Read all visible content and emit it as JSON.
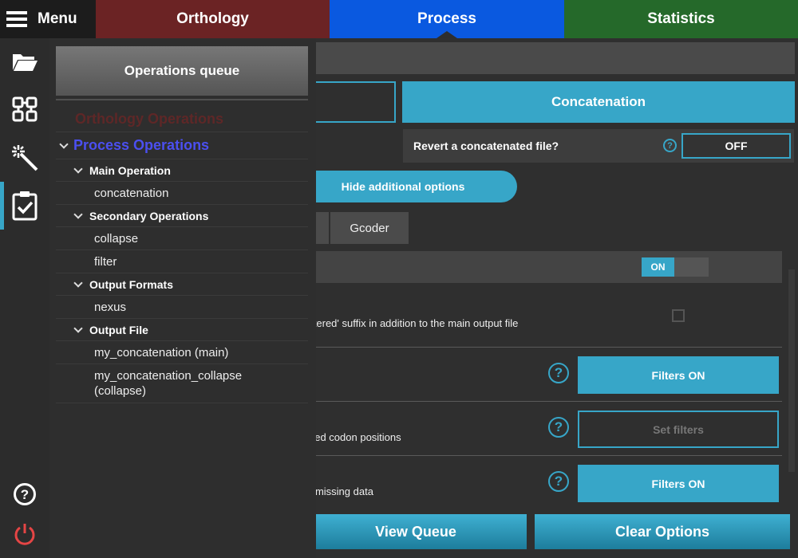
{
  "menu": {
    "label": "Menu"
  },
  "tabs": [
    {
      "label": "Orthology",
      "color": "#6b2324"
    },
    {
      "label": "Process",
      "color": "#0a59e0",
      "active": true
    },
    {
      "label": "Statistics",
      "color": "#25692a"
    }
  ],
  "rail": {
    "icons": [
      "folder-open-icon",
      "modules-icon",
      "magic-wand-icon",
      "clipboard-check-icon",
      "help-icon",
      "power-icon"
    ],
    "active": "clipboard-check-icon"
  },
  "main": {
    "concatenation_label": "Concatenation",
    "revert_label": "Revert a concatenated file?",
    "revert_toggle": "OFF",
    "hide_options_label": "Hide additional options",
    "gcoder_label": "Gcoder",
    "toggle_on_label": "ON",
    "suffix_desc": "iltered' suffix in addition to the main output file",
    "codon_desc": "ded codon positions",
    "missing_desc": "r missing data",
    "filters_on_1": "Filters ON",
    "set_filters": "Set filters",
    "filters_on_2": "Filters ON",
    "help_glyph": "?"
  },
  "bottom": {
    "view_queue": "View Queue",
    "clear_options": "Clear Options"
  },
  "queue": {
    "header": "Operations queue",
    "orthology_ops": "Orthology Operations",
    "process_ops": "Process Operations",
    "main_operation": "Main Operation",
    "main_items": [
      "concatenation"
    ],
    "secondary_operations": "Secondary Operations",
    "secondary_items": [
      "collapse",
      "filter"
    ],
    "output_formats": "Output Formats",
    "format_items": [
      "nexus"
    ],
    "output_file": "Output File",
    "file_items": [
      "my_concatenation (main)",
      "my_concatenation_collapse",
      "(collapse)"
    ]
  },
  "colors": {
    "accent": "#37a6c8",
    "orthology_disabled": "#5e2727",
    "process_link": "#4b4ff0"
  }
}
